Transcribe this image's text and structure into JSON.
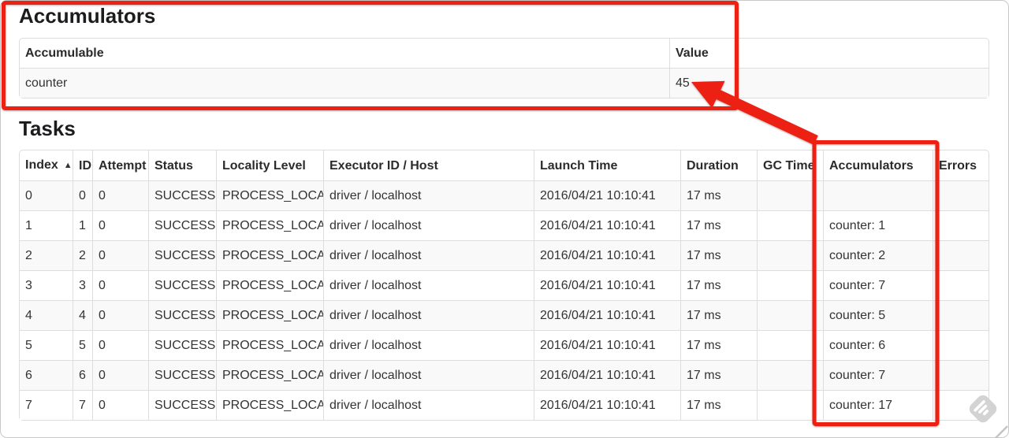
{
  "accumulators_section": {
    "title": "Accumulators",
    "table": {
      "headers": [
        "Accumulable",
        "Value"
      ],
      "rows": [
        [
          "counter",
          "45"
        ]
      ]
    }
  },
  "tasks_section": {
    "title": "Tasks",
    "table": {
      "headers": [
        "Index",
        "ID",
        "Attempt",
        "Status",
        "Locality Level",
        "Executor ID / Host",
        "Launch Time",
        "Duration",
        "GC Time",
        "Accumulators",
        "Errors"
      ],
      "sorted_column": "Index",
      "sort_indicator": "▲",
      "rows": [
        [
          "0",
          "0",
          "0",
          "SUCCESS",
          "PROCESS_LOCAL",
          "driver / localhost",
          "2016/04/21 10:10:41",
          "17 ms",
          "",
          "",
          ""
        ],
        [
          "1",
          "1",
          "0",
          "SUCCESS",
          "PROCESS_LOCAL",
          "driver / localhost",
          "2016/04/21 10:10:41",
          "17 ms",
          "",
          "counter: 1",
          ""
        ],
        [
          "2",
          "2",
          "0",
          "SUCCESS",
          "PROCESS_LOCAL",
          "driver / localhost",
          "2016/04/21 10:10:41",
          "17 ms",
          "",
          "counter: 2",
          ""
        ],
        [
          "3",
          "3",
          "0",
          "SUCCESS",
          "PROCESS_LOCAL",
          "driver / localhost",
          "2016/04/21 10:10:41",
          "17 ms",
          "",
          "counter: 7",
          ""
        ],
        [
          "4",
          "4",
          "0",
          "SUCCESS",
          "PROCESS_LOCAL",
          "driver / localhost",
          "2016/04/21 10:10:41",
          "17 ms",
          "",
          "counter: 5",
          ""
        ],
        [
          "5",
          "5",
          "0",
          "SUCCESS",
          "PROCESS_LOCAL",
          "driver / localhost",
          "2016/04/21 10:10:41",
          "17 ms",
          "",
          "counter: 6",
          ""
        ],
        [
          "6",
          "6",
          "0",
          "SUCCESS",
          "PROCESS_LOCAL",
          "driver / localhost",
          "2016/04/21 10:10:41",
          "17 ms",
          "",
          "counter: 7",
          ""
        ],
        [
          "7",
          "7",
          "0",
          "SUCCESS",
          "PROCESS_LOCAL",
          "driver / localhost",
          "2016/04/21 10:10:41",
          "17 ms",
          "",
          "counter: 17",
          ""
        ]
      ]
    }
  },
  "annotations": {
    "color": "#ec2113",
    "highlighted_regions": [
      "accumulators-section",
      "tasks-accumulators-column"
    ],
    "arrow_points_to": "45"
  }
}
